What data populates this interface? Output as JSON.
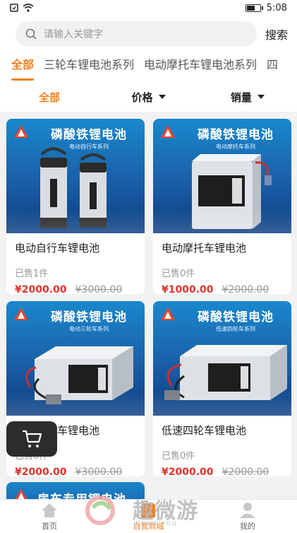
{
  "status_bar": {
    "time": "5:08",
    "signal_label": "",
    "battery_level": 0.6
  },
  "search": {
    "placeholder": "请输入关键字",
    "button_label": "搜索"
  },
  "category_tabs": [
    {
      "label": "全部",
      "active": true
    },
    {
      "label": "三轮车锂电池系列",
      "active": false
    },
    {
      "label": "电动摩托车锂电池系列",
      "active": false
    },
    {
      "label": "四",
      "active": false
    }
  ],
  "sort_bar": {
    "all_label": "全部",
    "price_label": "价格",
    "sales_label": "销量"
  },
  "products": [
    {
      "banner_title": "磷酸铁锂电池",
      "banner_subtitle": "电动自行车系列",
      "name": "电动自行车锂电池",
      "sold": "已售1件",
      "price": "¥2000.00",
      "original_price": "¥3000.00"
    },
    {
      "banner_title": "磷酸铁锂电池",
      "banner_subtitle": "电动摩托车系列",
      "name": "电动摩托车锂电池",
      "sold": "已售0件",
      "price": "¥1000.00",
      "original_price": "¥2000.00"
    },
    {
      "banner_title": "磷酸铁锂电池",
      "banner_subtitle": "电动三轮车系列",
      "name": "电动三轮车锂电池",
      "sold": "已售0件",
      "price": "¥2000.00",
      "original_price": "¥3000.00"
    },
    {
      "banner_title": "磷酸铁锂电池",
      "banner_subtitle": "低速四轮车系列",
      "name": "低速四轮车锂电池",
      "sold": "已售0件",
      "price": "¥2000.00",
      "original_price": "¥2000.00"
    }
  ],
  "partial_product": {
    "banner_title": "房车专用锂电池"
  },
  "bottom_nav": [
    {
      "label": "首页",
      "active": false
    },
    {
      "label": "自营商城",
      "active": true
    },
    {
      "label": "我的",
      "active": false
    }
  ],
  "watermark": {
    "text": "趣微游",
    "subtext": "QUWEIYOU"
  },
  "colors": {
    "accent": "#f08020",
    "price": "#e0322a",
    "banner": "#1a5fa8"
  }
}
